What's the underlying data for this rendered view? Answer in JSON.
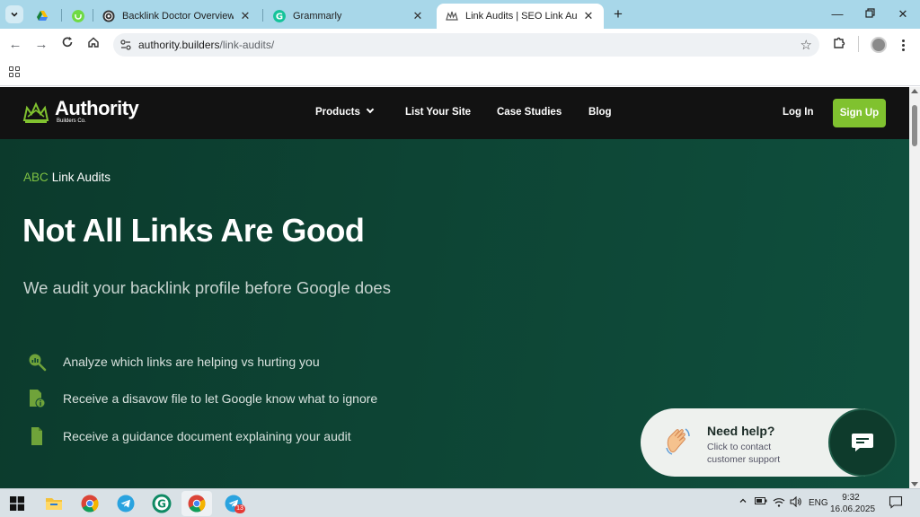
{
  "browser": {
    "tabs": [
      {
        "title": "",
        "favicon": "google-drive-icon"
      },
      {
        "title": "",
        "favicon": "upwork-icon"
      },
      {
        "title": "Backlink Doctor Overview",
        "favicon": "backlink-doctor-icon"
      },
      {
        "title": "Grammarly",
        "favicon": "grammarly-icon"
      },
      {
        "title": "Link Audits | SEO Link Audit Ser",
        "favicon": "authority-builders-icon",
        "active": true
      }
    ],
    "url_host": "authority.builders",
    "url_path": "/link-audits/"
  },
  "site": {
    "logo_name": "Authority",
    "logo_sub": "Builders Co.",
    "nav": {
      "products": "Products",
      "list_site": "List Your Site",
      "case_studies": "Case Studies",
      "blog": "Blog",
      "login": "Log In",
      "signup": "Sign Up"
    },
    "hero": {
      "eyebrow_abc": "ABC",
      "eyebrow_rest": "Link Audits",
      "title": "Not All Links Are Good",
      "subtitle": "We audit your backlink profile before Google does",
      "features": [
        {
          "text": "Analyze which links are helping vs hurting you",
          "icon": "magnifier-chart-icon"
        },
        {
          "text": "Receive a disavow file to let Google know what to ignore",
          "icon": "file-info-icon"
        },
        {
          "text": "Receive a guidance document explaining your audit",
          "icon": "document-icon"
        }
      ]
    },
    "help": {
      "title": "Need help?",
      "subtitle": "Click to contact customer support"
    }
  },
  "taskbar": {
    "language": "ENG",
    "time": "9:32",
    "date": "16.06.2025",
    "telegram_badge": "13"
  },
  "colors": {
    "accent_green": "#80c22f",
    "hero_bg": "#0d4434",
    "header_bg": "#121212",
    "tabstrip_bg": "#a8d7e9"
  }
}
